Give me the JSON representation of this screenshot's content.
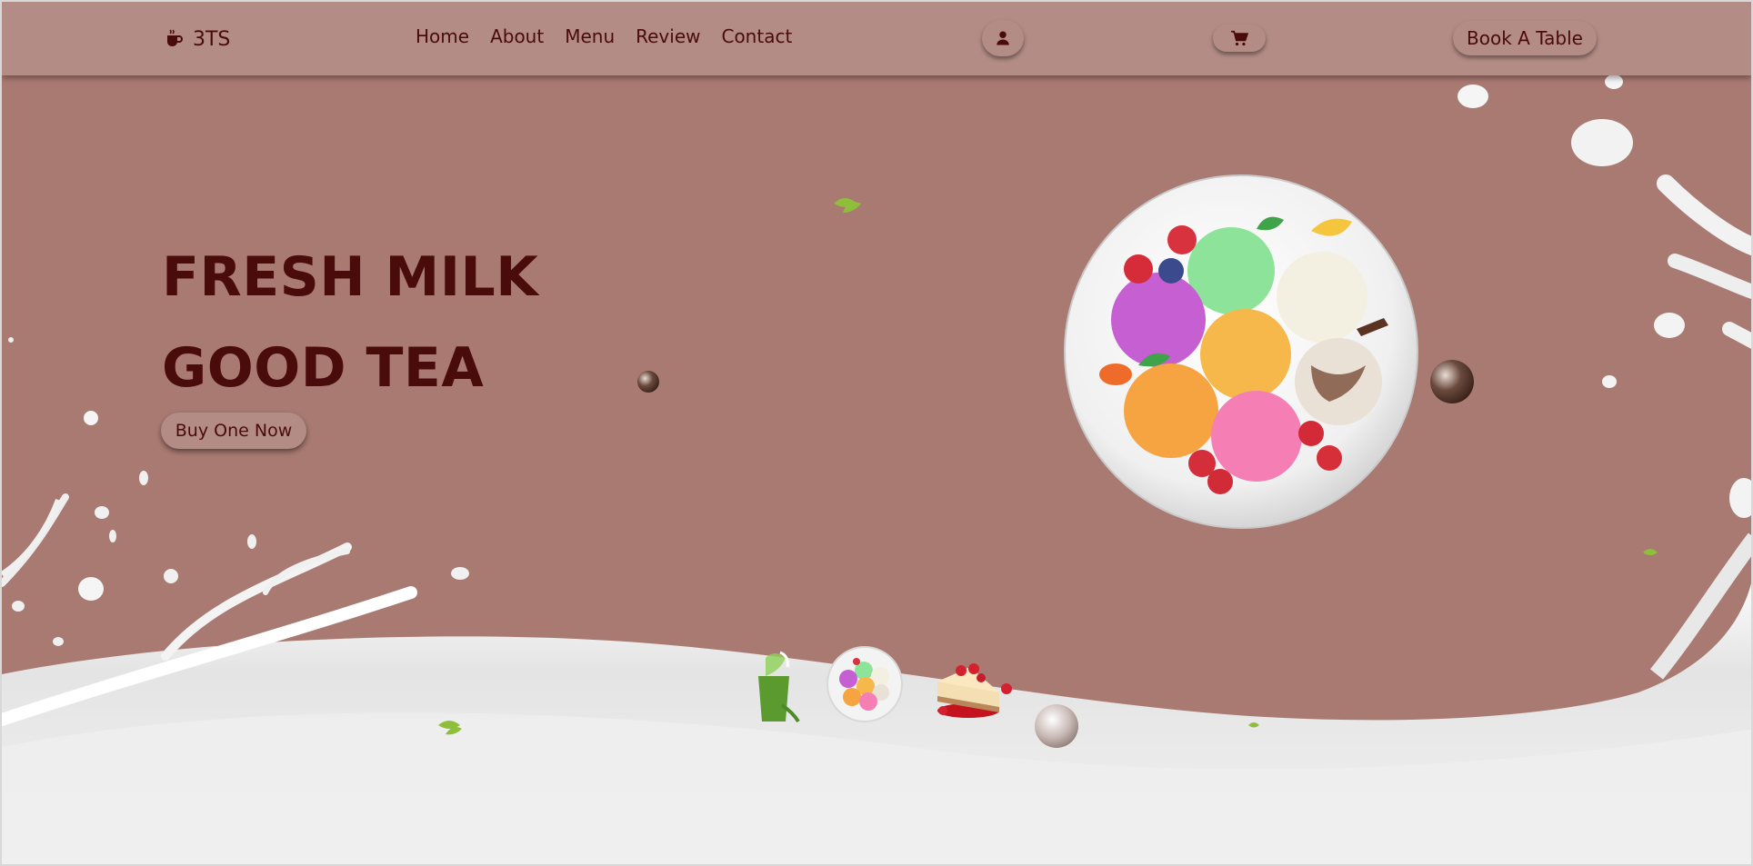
{
  "brand": {
    "name": "3TS",
    "icon": "coffee-cup-icon"
  },
  "nav": {
    "items": [
      "Home",
      "About",
      "Menu",
      "Review",
      "Contact"
    ]
  },
  "header": {
    "user_icon": "user-icon",
    "cart_icon": "cart-icon",
    "book_label": "Book A Table"
  },
  "hero": {
    "line1": "FRESH MILK",
    "line2": "GOOD TEA",
    "cta_label": "Buy One Now"
  },
  "thumbnails": [
    "green-drink-thumbnail",
    "ice-cream-plate-thumbnail",
    "cheesecake-thumbnail"
  ],
  "colors": {
    "background": "#a97a71",
    "header": "#b38c85",
    "text": "#4a0b0b",
    "milk": "#e8e8e8"
  }
}
